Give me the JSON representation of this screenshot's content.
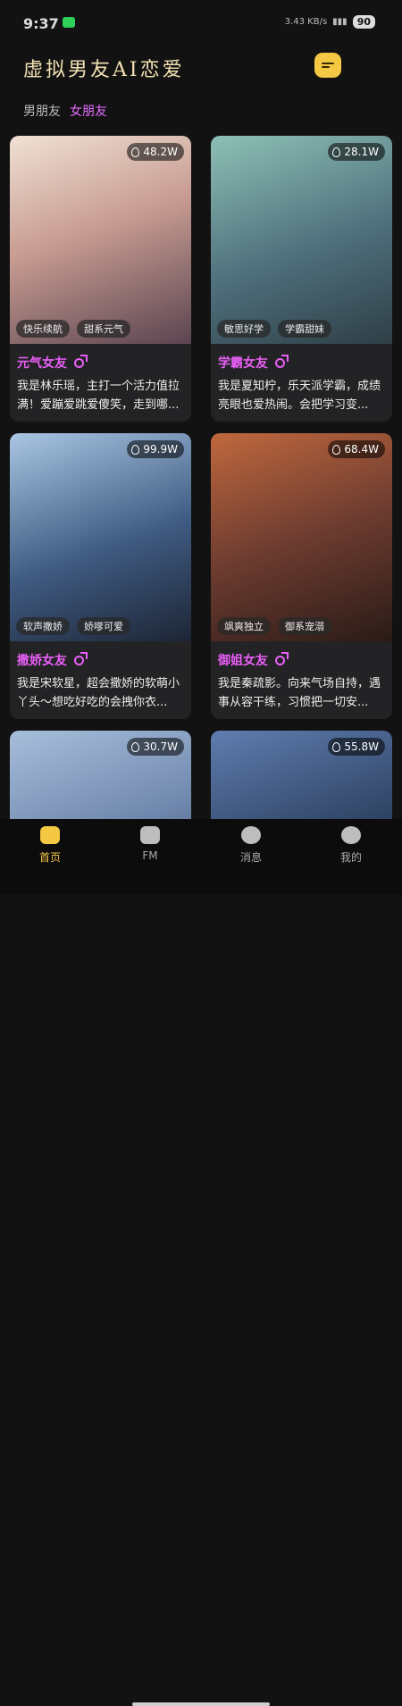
{
  "status": {
    "time": "9:37",
    "network": "3.43 KB/s",
    "battery": "90"
  },
  "header": {
    "title": "虚拟男友AI恋爱",
    "chat_icon": "message-icon"
  },
  "tabs": [
    {
      "label": "男朋友",
      "active": false
    },
    {
      "label": "女朋友",
      "active": true
    }
  ],
  "cards": [
    {
      "views": "48.2W",
      "tags": [
        "快乐续航",
        "甜系元气"
      ],
      "name": "元气女友",
      "desc": "我是林乐瑶，主打一个活力值拉满！爱蹦爱跳爱傻笑，走到哪...",
      "palette": [
        "#e9d3c7",
        "#b98a84",
        "#5b4450"
      ]
    },
    {
      "views": "28.1W",
      "tags": [
        "敏思好学",
        "学霸甜妹"
      ],
      "name": "学霸女友",
      "desc": "我是夏知柠，乐天派学霸，成绩亮眼也爱热闹。会把学习变...",
      "palette": [
        "#79a8a2",
        "#4e6f7c",
        "#2f3f47"
      ]
    },
    {
      "views": "99.9W",
      "tags": [
        "软声撒娇",
        "娇嗲可爱"
      ],
      "name": "撒娇女友",
      "desc": "我是宋软星，超会撒娇的软萌小丫头～想吃好吃的会拽你衣...",
      "palette": [
        "#8fb2cf",
        "#3f5b82",
        "#1d2535"
      ]
    },
    {
      "views": "68.4W",
      "tags": [
        "飒爽独立",
        "御系宠溺"
      ],
      "name": "御姐女友",
      "desc": "我是秦疏影。向来气场自持，遇事从容干练，习惯把一切安...",
      "palette": [
        "#b0623e",
        "#6e3c30",
        "#2a1b17"
      ]
    },
    {
      "views": "30.7W",
      "tags": [],
      "name": "",
      "desc": "",
      "palette": [
        "#9ab0cf",
        "#6f87ad",
        "#2a3446"
      ]
    },
    {
      "views": "55.8W",
      "tags": [],
      "name": "",
      "desc": "",
      "palette": [
        "#4f6b9d",
        "#2f4363",
        "#151b2b"
      ]
    }
  ],
  "nav": [
    {
      "label": "首页",
      "icon": "home-icon",
      "active": true
    },
    {
      "label": "FM",
      "icon": "radio-icon",
      "active": false
    },
    {
      "label": "消息",
      "icon": "message-icon",
      "active": false
    },
    {
      "label": "我的",
      "icon": "profile-icon",
      "active": false
    }
  ]
}
